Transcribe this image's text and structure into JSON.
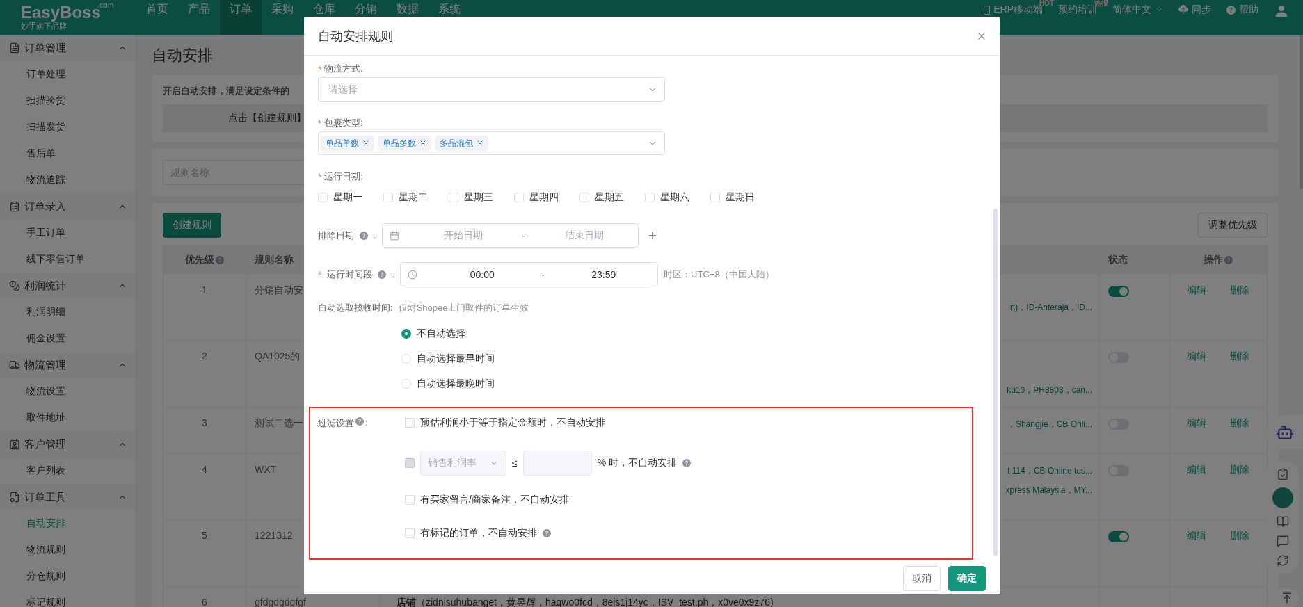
{
  "top_nav": {
    "logo": {
      "name": "EasyBoss",
      "domain": ".com",
      "tagline": "妙手旗下品牌"
    },
    "items": [
      {
        "label": "首页",
        "selected": false
      },
      {
        "label": "产品",
        "selected": false
      },
      {
        "label": "订单",
        "selected": true
      },
      {
        "label": "采购",
        "selected": false
      },
      {
        "label": "仓库",
        "selected": false
      },
      {
        "label": "分销",
        "selected": false
      },
      {
        "label": "数据",
        "selected": false
      },
      {
        "label": "系统",
        "selected": false
      }
    ],
    "right": [
      {
        "kind": "mobile",
        "label": "ERP移动端",
        "badge": "HOT"
      },
      {
        "kind": "plain",
        "label": "预约培训",
        "badge": "热报"
      },
      {
        "kind": "dropdown",
        "label": "简体中文"
      },
      {
        "kind": "sync",
        "label": "同步"
      },
      {
        "kind": "help",
        "label": "帮助"
      }
    ]
  },
  "sidebar": {
    "groups": [
      {
        "kind": "order",
        "label": "订单管理",
        "expanded": true,
        "children": [
          {
            "label": "订单处理",
            "selected": false
          },
          {
            "label": "扫描验货",
            "selected": false
          },
          {
            "label": "扫描发货",
            "selected": false
          },
          {
            "label": "售后单",
            "selected": false
          },
          {
            "label": "物流追踪",
            "selected": false
          }
        ]
      },
      {
        "kind": "entry",
        "label": "订单录入",
        "expanded": true,
        "children": [
          {
            "label": "手工订单",
            "selected": false
          },
          {
            "label": "线下零售订单",
            "selected": false
          }
        ]
      },
      {
        "kind": "profit",
        "label": "利润统计",
        "expanded": true,
        "children": [
          {
            "label": "利润明细",
            "selected": false
          },
          {
            "label": "佣金设置",
            "selected": false
          }
        ]
      },
      {
        "kind": "logistics",
        "label": "物流管理",
        "expanded": true,
        "children": [
          {
            "label": "物流设置",
            "selected": false
          },
          {
            "label": "取件地址",
            "selected": false
          }
        ]
      },
      {
        "kind": "customer",
        "label": "客户管理",
        "expanded": true,
        "children": [
          {
            "label": "客户列表",
            "selected": false
          }
        ]
      },
      {
        "kind": "tools",
        "label": "订单工具",
        "expanded": true,
        "children": [
          {
            "label": "自动安排",
            "selected": true
          },
          {
            "label": "物流规则",
            "selected": false
          },
          {
            "label": "分仓规则",
            "selected": false
          },
          {
            "label": "标记规则",
            "selected": false
          }
        ]
      }
    ]
  },
  "main": {
    "title": "自动安排",
    "notice": "开启自动安排，满足设定条件的",
    "step": "点击【创建规则】",
    "search": {
      "placeholder": "规则名称"
    },
    "create_button": "创建规则",
    "priority_button": "调整优先级",
    "table": {
      "columns": [
        {
          "label": "优先级",
          "help": true
        },
        {
          "label": "规则名称",
          "help": false
        },
        {
          "label": "状态",
          "help": false
        },
        {
          "label": "操作",
          "help": true
        }
      ],
      "rows": [
        {
          "priority": "1",
          "name": "分销自动安",
          "detail": [
            "rt)，ID-Anteraja，ID..."
          ],
          "on": true,
          "actions": [
            "编辑",
            "删除"
          ]
        },
        {
          "priority": "2",
          "name": "QA1025的",
          "detail": [
            "ku10，PH8803，can..."
          ],
          "on": false,
          "actions": [
            "编辑",
            "删除"
          ]
        },
        {
          "priority": "3",
          "name": "测试二选一",
          "detail": [
            "，Shangjie，CB Onli..."
          ],
          "on": false,
          "actions": [
            "编辑",
            "删除"
          ]
        },
        {
          "priority": "4",
          "name": "WXT",
          "detail": [
            "t 114，CB Online tes...",
            "xpress Malaysia，MY..."
          ],
          "on": false,
          "actions": [
            "编辑",
            "删除"
          ]
        },
        {
          "priority": "5",
          "name": "1221312",
          "on": true,
          "actions": [
            "编辑",
            "删除"
          ]
        },
        {
          "priority": "6",
          "name": "gfdgdgdgfgf",
          "detail": [
            "**店铺**（zidnisuhubanget，黄昱辉，haqwo0fcd，8ejs1j14yc，ISV_test.ph，x0ve0x9z76)"
          ]
        }
      ]
    }
  },
  "modal": {
    "title": "自动安排规则",
    "fields": [
      {
        "kind": "select",
        "mark": "*",
        "label": "物流方式:",
        "placeholder": "请选择"
      },
      {
        "kind": "tags",
        "mark": "*",
        "label": "包裹类型:",
        "tags": [
          "单品单数",
          "单品多数",
          "多品混包"
        ]
      },
      {
        "kind": "weekdays",
        "mark": "*",
        "label": "运行日期:",
        "options": [
          {
            "label": "星期一",
            "checked": false
          },
          {
            "label": "星期二",
            "checked": false
          },
          {
            "label": "星期三",
            "checked": false
          },
          {
            "label": "星期四",
            "checked": false
          },
          {
            "label": "星期五",
            "checked": false
          },
          {
            "label": "星期六",
            "checked": false
          },
          {
            "label": "星期日",
            "checked": false
          }
        ]
      },
      {
        "kind": "date-range",
        "label": "排除日期",
        "help": true,
        "colon": ":",
        "start_placeholder": "开始日期",
        "separator": "-",
        "end_placeholder": "结束日期"
      },
      {
        "kind": "time-range",
        "mark": "*",
        "label": "运行时间段",
        "help": true,
        "colon": ":",
        "start": "00:00",
        "separator": "-",
        "end": "23:59",
        "note": "时区：UTC+8（中国大陆）"
      },
      {
        "kind": "radios",
        "label": "自动选取揽收时间:",
        "hint": "仅对Shopee上门取件的订单生效",
        "options": [
          {
            "label": "不自动选择",
            "selected": true
          },
          {
            "label": "自动选择最早时间",
            "selected": false
          },
          {
            "label": "自动选择最晚时间",
            "selected": false
          }
        ]
      }
    ],
    "filter": {
      "label": "过滤设置",
      "colon": ":",
      "rules": [
        {
          "kind": "plain",
          "label": "预估利润小于等于指定金额时，不自动安排",
          "checked": false,
          "disabled": false,
          "help": false
        },
        {
          "kind": "threshold",
          "select": "销售利润率",
          "operator": "≤",
          "suffix": "% 时，不自动安排",
          "checked": false,
          "disabled": true,
          "help": true
        },
        {
          "kind": "plain",
          "label": "有买家留言/商家备注，不自动安排",
          "checked": false,
          "disabled": false,
          "help": false
        },
        {
          "kind": "plain",
          "label": "有标记的订单，不自动安排",
          "checked": false,
          "disabled": false,
          "help": true
        }
      ]
    },
    "buttons": [
      {
        "kind": "secondary",
        "label": "取消"
      },
      {
        "kind": "primary",
        "label": "确定"
      }
    ]
  }
}
